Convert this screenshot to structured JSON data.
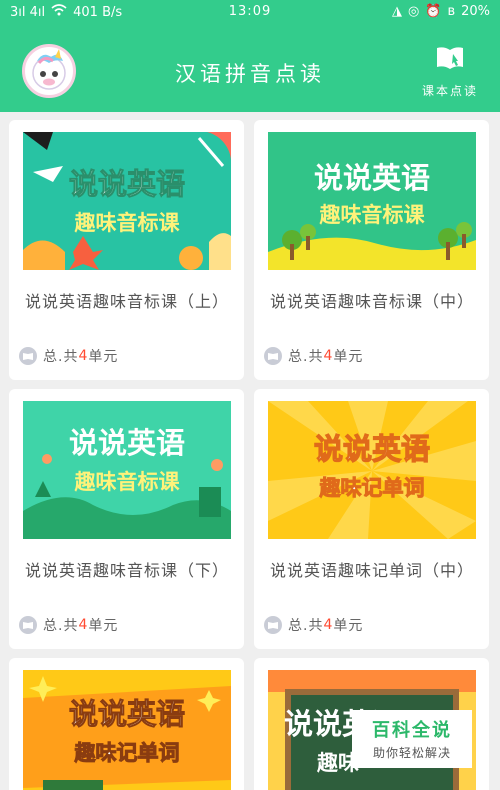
{
  "status_bar": {
    "signal": "3ıl 4ıl",
    "speed": "401 B/s",
    "time": "13:09",
    "battery": "20%"
  },
  "header": {
    "title": "汉语拼音点读",
    "book_button_label": "课本点读"
  },
  "courses": [
    {
      "name": "说说英语趣味音标课（上）",
      "banner_title": "说说英语",
      "banner_subtitle": "趣味音标课",
      "meta_prefix": "总.共",
      "unit_count": "4",
      "meta_suffix": "单元"
    },
    {
      "name": "说说英语趣味音标课（中）",
      "banner_title": "说说英语",
      "banner_subtitle": "趣味音标课",
      "meta_prefix": "总.共",
      "unit_count": "4",
      "meta_suffix": "单元"
    },
    {
      "name": "说说英语趣味音标课（下）",
      "banner_title": "说说英语",
      "banner_subtitle": "趣味音标课",
      "meta_prefix": "总.共",
      "unit_count": "4",
      "meta_suffix": "单元"
    },
    {
      "name": "说说英语趣味记单词（中）",
      "banner_title": "说说英语",
      "banner_subtitle": "趣味记单词",
      "meta_prefix": "总.共",
      "unit_count": "4",
      "meta_suffix": "单元"
    },
    {
      "name": "",
      "banner_title": "说说英语",
      "banner_subtitle": "趣味记单词"
    },
    {
      "name": "",
      "banner_title": "说说英语",
      "banner_subtitle": "趣味"
    }
  ],
  "watermark": {
    "title": "百科全说",
    "subtitle": "助你轻松解决"
  },
  "colors": {
    "theme_green": "#33cc8c",
    "count_red": "#ff4b33"
  }
}
